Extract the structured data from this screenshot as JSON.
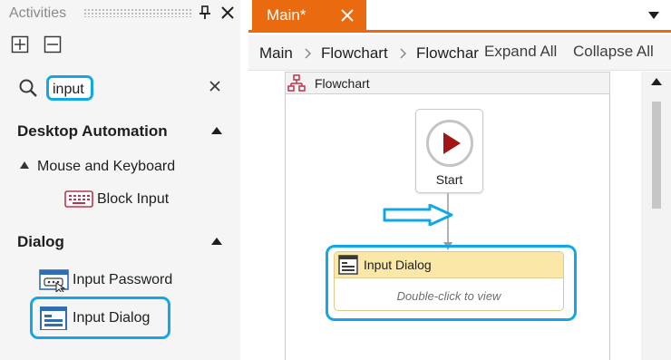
{
  "activities_panel": {
    "title": "Activities",
    "pin_icon": "pin-icon",
    "close_icon": "close-icon",
    "toolbar": {
      "expand_icon": "expand-all-icon",
      "collapse_icon": "collapse-all-icon"
    },
    "search": {
      "value": "input",
      "search_icon": "search-icon",
      "clear_icon": "clear-icon"
    },
    "categories": [
      {
        "label": "Desktop Automation",
        "expanded": true,
        "subcategories": [
          {
            "label": "Mouse and Keyboard",
            "items": [
              {
                "label": "Block Input",
                "icon": "keyboard-icon"
              }
            ]
          }
        ]
      },
      {
        "label": "Dialog",
        "expanded": true,
        "items": [
          {
            "label": "Input Password",
            "icon": "password-window-icon"
          },
          {
            "label": "Input Dialog",
            "icon": "input-dialog-icon",
            "highlighted": true
          }
        ]
      }
    ]
  },
  "designer": {
    "tab": {
      "label": "Main*",
      "close_icon": "close-icon"
    },
    "breadcrumb": [
      "Main",
      "Flowchart",
      "Flowchar"
    ],
    "expand_all": "Expand All",
    "collapse_all": "Collapse All",
    "flowchart": {
      "title": "Flowchart",
      "start_label": "Start",
      "activity": {
        "title": "Input Dialog",
        "hint": "Double-click to view"
      }
    }
  },
  "colors": {
    "accent_orange": "#ea6a10",
    "highlight_blue": "#12a8e6",
    "start_red": "#a31618",
    "activity_header": "#fbe7a8"
  }
}
